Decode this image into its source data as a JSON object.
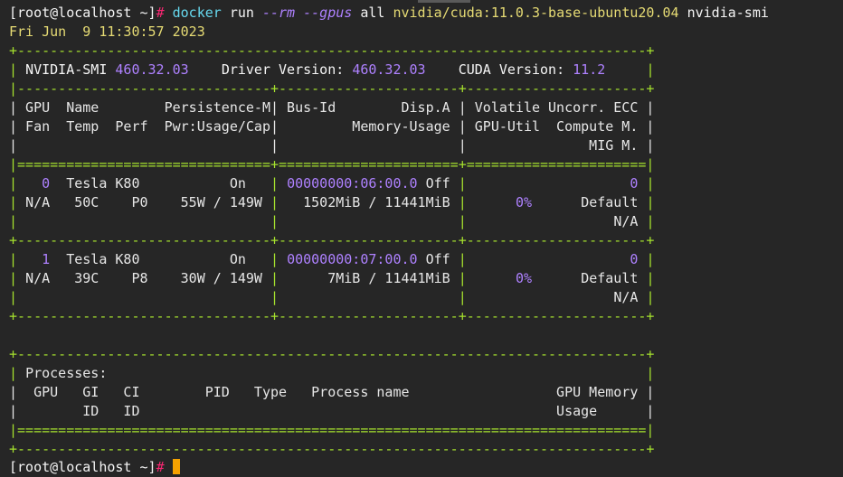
{
  "prompt": {
    "user_host": "[root@localhost ~]",
    "symbol": "#"
  },
  "command": {
    "cmd": "docker",
    "sub": "run",
    "rm_flag": "--rm",
    "gpus_flag": "--gpus",
    "gpus_val": "all",
    "image": "nvidia/cuda:11.0.3-base-ubuntu20.04",
    "run_cmd": "nvidia-smi"
  },
  "date_line": "Fri Jun  9 11:30:57 2023",
  "table": {
    "border_top": "+-----------------------------------------------------------------------------+",
    "smi_label": "NVIDIA-SMI",
    "smi_version": "460.32.03",
    "driver_label": "Driver Version:",
    "driver_version": "460.32.03",
    "cuda_label": "CUDA Version:",
    "cuda_version": "11.2",
    "sep_dash": "|-------------------------------+----------------------+----------------------+",
    "hdr1": "| GPU  Name        Persistence-M| Bus-Id        Disp.A | Volatile Uncorr. ECC |",
    "hdr2": "| Fan  Temp  Perf  Pwr:Usage/Cap|         Memory-Usage | GPU-Util  Compute M. |",
    "hdr3": "|                               |                      |               MIG M. |",
    "sep_eq": "|===============================+======================+======================|",
    "gpu_sep": "+-------------------------------+----------------------+----------------------+",
    "gpus": [
      {
        "index": "0",
        "name": "Tesla K80",
        "persistence": "On",
        "bus_id": "00000000:06:00.0",
        "disp": "Off",
        "ecc": "0",
        "fan": "N/A",
        "temp": "50C",
        "perf": "P0",
        "pwr": "55W / 149W",
        "memory": "1502MiB / 11441MiB",
        "util": "0%",
        "compute": "Default",
        "mig": "N/A"
      },
      {
        "index": "1",
        "name": "Tesla K80",
        "persistence": "On",
        "bus_id": "00000000:07:00.0",
        "disp": "Off",
        "ecc": "0",
        "fan": "N/A",
        "temp": "39C",
        "perf": "P8",
        "pwr": "30W / 149W",
        "memory": "7MiB / 11441MiB",
        "util": "0%",
        "compute": "Default",
        "mig": "N/A"
      }
    ]
  },
  "processes": {
    "border": "+-----------------------------------------------------------------------------+",
    "title": "Processes:",
    "hdr1": "|  GPU   GI   CI        PID   Type   Process name                  GPU Memory |",
    "hdr2": "|        ID   ID                                                   Usage      |",
    "sep_eq": "|=============================================================================|"
  },
  "colors": {
    "background": "#262626",
    "green": "#a6e22e",
    "blue": "#66d9ef",
    "yellow": "#e6db74",
    "purple": "#ae81ff",
    "cursor": "#f5a100"
  }
}
